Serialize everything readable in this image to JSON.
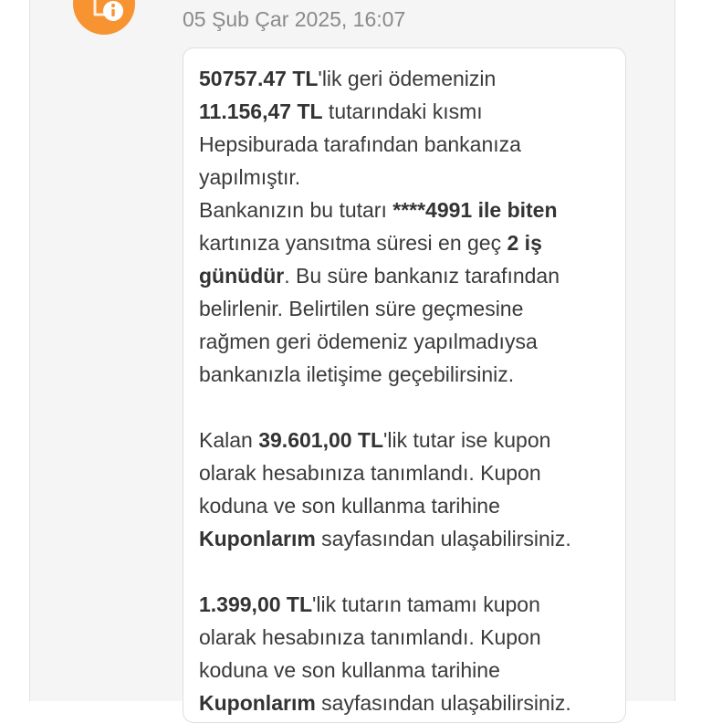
{
  "message": {
    "timestamp": "05 Şub Çar 2025, 16:07",
    "p1_amount": "50757.47 TL",
    "p1_a": "'lik geri ödemenizin",
    "p1_partial": "11.156,47 TL",
    "p1_b": " tutarındaki kısmı",
    "p1_c": "Hepsiburada tarafından bankanıza",
    "p1_d": "yapılmıştır.",
    "p1_e": "Bankanızın bu tutarı ",
    "p1_card": "****4991 ile biten",
    "p1_f": "kartınıza yansıtma süresi en geç ",
    "p1_days1": "2 iş",
    "p1_days2": "günüdür",
    "p1_g": ". Bu süre bankanız tarafından",
    "p1_h": "belirlenir. Belirtilen süre geçmesine",
    "p1_i": "rağmen geri ödemeniz yapılmadıysa",
    "p1_j": "bankanızla iletişime geçebilirsiniz.",
    "p2_a": "Kalan ",
    "p2_amount": "39.601,00 TL",
    "p2_b": "'lik tutar ise kupon",
    "p2_c": "olarak hesabınıza tanımlandı. Kupon",
    "p2_d": "koduna ve son kullanma tarihine",
    "p2_link": "Kuponlarım",
    "p2_e": " sayfasından ulaşabilirsiniz.",
    "p3_amount": "1.399,00 TL",
    "p3_a": "'lik tutarın tamamı kupon",
    "p3_b": "olarak hesabınıza tanımlandı. Kupon",
    "p3_c": "koduna ve son kullanma tarihine",
    "p3_link": "Kuponlarım",
    "p3_d": " sayfasından ulaşabilirsiniz."
  },
  "colors": {
    "avatar": "#f79330",
    "timestamp": "#8a8a8a",
    "text": "#3a3a3a",
    "panel": "#f5f5f5"
  },
  "icons": {
    "avatar": "info-notification-icon"
  }
}
